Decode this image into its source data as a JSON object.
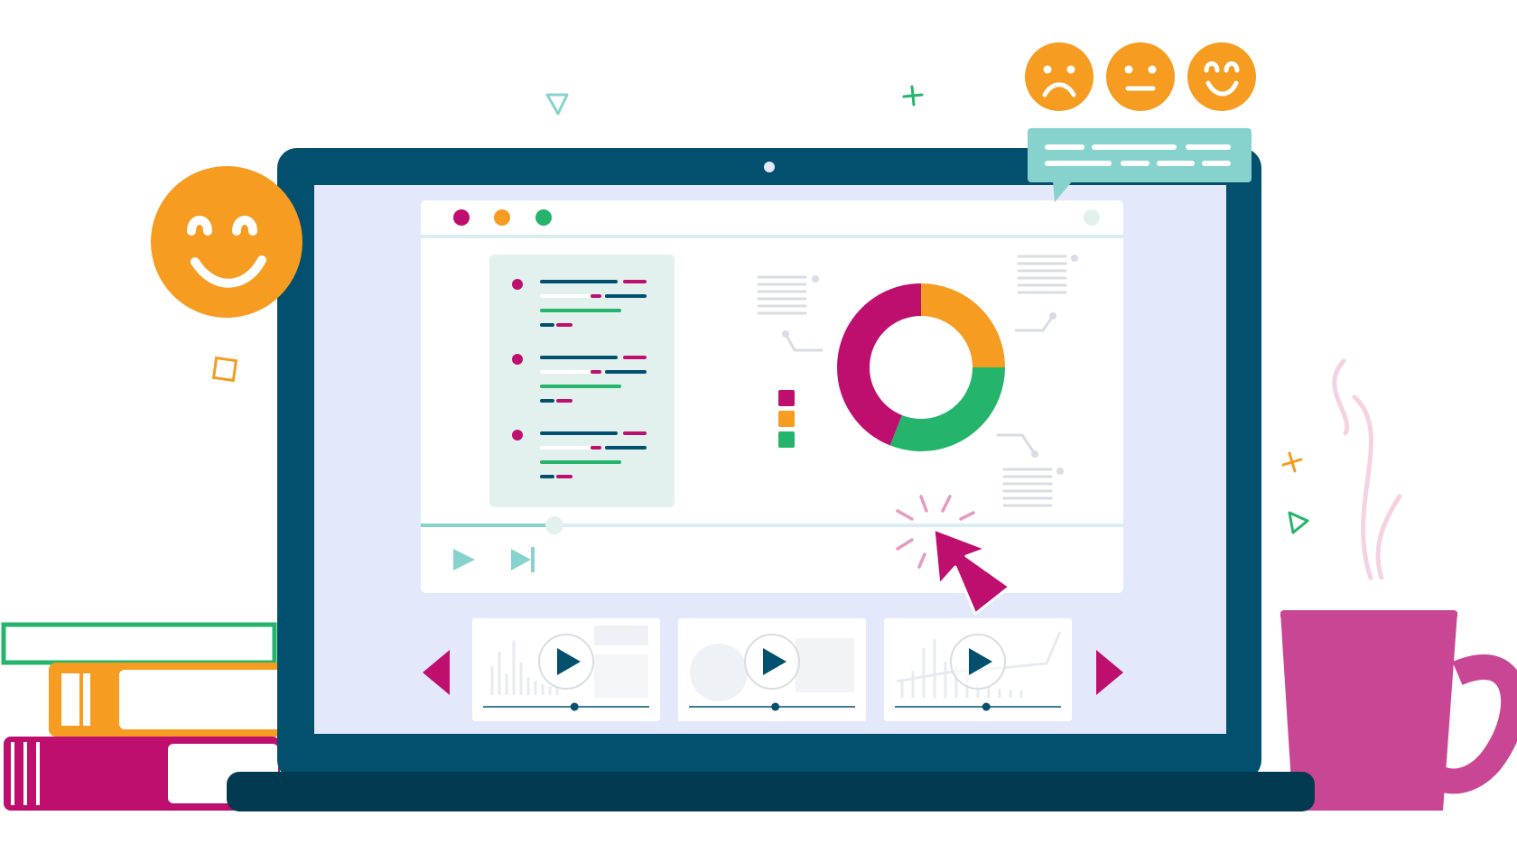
{
  "colors": {
    "navy": "#02506E",
    "navy_dark": "#023A52",
    "screen": "#E4E8FB",
    "panel": "#FFFFFF",
    "panel_soft": "#E3F1EE",
    "magenta": "#BE0F6E",
    "orange": "#F59C21",
    "green": "#25B46B",
    "teal": "#86D3CE",
    "mug": "#C94694",
    "line_grey": "#D8DCE4"
  },
  "window_controls": [
    "close-dot",
    "minimize-dot",
    "maximize-dot"
  ],
  "donut": {
    "segments": [
      {
        "color_key": "orange",
        "fraction": 0.25
      },
      {
        "color_key": "green",
        "fraction": 0.31
      },
      {
        "color_key": "magenta",
        "fraction": 0.44
      }
    ]
  },
  "legend_swatches": [
    "magenta",
    "orange",
    "green"
  ],
  "feedback_faces": [
    "sad-face-icon",
    "neutral-face-icon",
    "happy-face-icon"
  ],
  "playback": {
    "progress": 0.19
  },
  "thumbnails": [
    {
      "name": "bar-chart-video",
      "progress": 0.55
    },
    {
      "name": "globe-video",
      "progress": 0.52
    },
    {
      "name": "line-chart-video",
      "progress": 0.55
    }
  ]
}
